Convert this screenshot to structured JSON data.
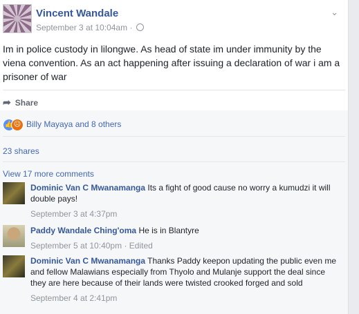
{
  "post": {
    "author": "Vincent Wandale",
    "timestamp": "September 3 at 10:04am",
    "separator": "·",
    "text": "Im in police custody in lilongwe. As head of state im under immunity by the viena convention. As an act happening after issuing a declaration of war i am a prisoner of war",
    "share_label": "Share",
    "chevron": "⌵"
  },
  "reactions": {
    "summary": "Billy Mayaya and 8 others",
    "shares": "23 shares",
    "view_more": "View 17 more comments"
  },
  "comments": [
    {
      "name": "Dominic Van C Mwanamanga",
      "text": "Its a fight of good cause no worry a kumudzi it will double pays!",
      "time": "September 3 at 4:37pm",
      "edited": ""
    },
    {
      "name": "Paddy Wandale Ching'oma",
      "text": "He is in Blantyre",
      "time": "September 5 at 10:40pm",
      "edited": "· Edited"
    },
    {
      "name": "Dominic Van C Mwanamanga",
      "text": "Thanks Paddy keepon updating the public even me and fellow Malawians especially from Thyolo and Mulanje support the deal since they are here because of their lands were twisted crooked forged and sold",
      "time": "September 4 at 2:41pm",
      "edited": ""
    }
  ],
  "colors": {
    "link": "#365899",
    "muted": "#90949c",
    "like": "#5890ff",
    "angry": "#e9710f"
  },
  "icons": [
    "globe-icon",
    "chevron-down-icon",
    "share-icon",
    "like-icon",
    "angry-icon"
  ]
}
